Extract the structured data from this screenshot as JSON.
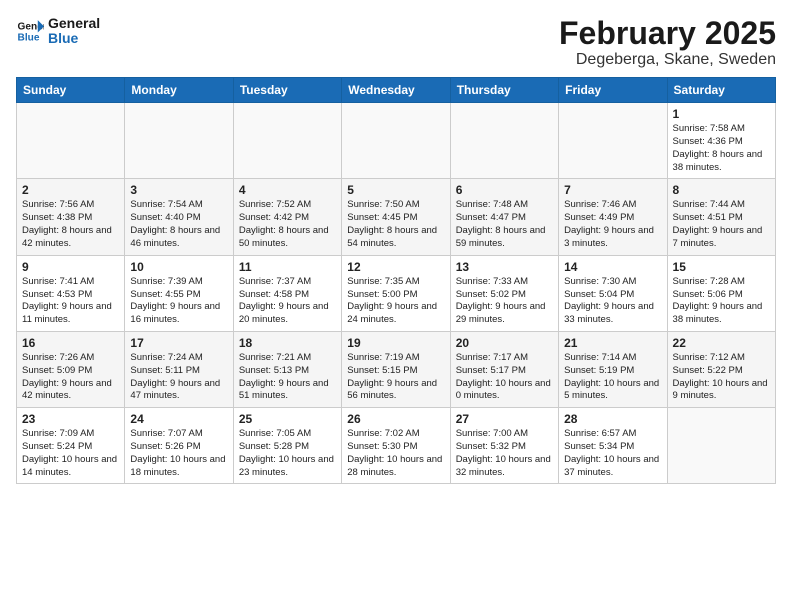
{
  "logo": {
    "line1": "General",
    "line2": "Blue"
  },
  "title": "February 2025",
  "location": "Degeberga, Skane, Sweden",
  "weekdays": [
    "Sunday",
    "Monday",
    "Tuesday",
    "Wednesday",
    "Thursday",
    "Friday",
    "Saturday"
  ],
  "weeks": [
    [
      {
        "day": "",
        "info": ""
      },
      {
        "day": "",
        "info": ""
      },
      {
        "day": "",
        "info": ""
      },
      {
        "day": "",
        "info": ""
      },
      {
        "day": "",
        "info": ""
      },
      {
        "day": "",
        "info": ""
      },
      {
        "day": "1",
        "info": "Sunrise: 7:58 AM\nSunset: 4:36 PM\nDaylight: 8 hours and 38 minutes."
      }
    ],
    [
      {
        "day": "2",
        "info": "Sunrise: 7:56 AM\nSunset: 4:38 PM\nDaylight: 8 hours and 42 minutes."
      },
      {
        "day": "3",
        "info": "Sunrise: 7:54 AM\nSunset: 4:40 PM\nDaylight: 8 hours and 46 minutes."
      },
      {
        "day": "4",
        "info": "Sunrise: 7:52 AM\nSunset: 4:42 PM\nDaylight: 8 hours and 50 minutes."
      },
      {
        "day": "5",
        "info": "Sunrise: 7:50 AM\nSunset: 4:45 PM\nDaylight: 8 hours and 54 minutes."
      },
      {
        "day": "6",
        "info": "Sunrise: 7:48 AM\nSunset: 4:47 PM\nDaylight: 8 hours and 59 minutes."
      },
      {
        "day": "7",
        "info": "Sunrise: 7:46 AM\nSunset: 4:49 PM\nDaylight: 9 hours and 3 minutes."
      },
      {
        "day": "8",
        "info": "Sunrise: 7:44 AM\nSunset: 4:51 PM\nDaylight: 9 hours and 7 minutes."
      }
    ],
    [
      {
        "day": "9",
        "info": "Sunrise: 7:41 AM\nSunset: 4:53 PM\nDaylight: 9 hours and 11 minutes."
      },
      {
        "day": "10",
        "info": "Sunrise: 7:39 AM\nSunset: 4:55 PM\nDaylight: 9 hours and 16 minutes."
      },
      {
        "day": "11",
        "info": "Sunrise: 7:37 AM\nSunset: 4:58 PM\nDaylight: 9 hours and 20 minutes."
      },
      {
        "day": "12",
        "info": "Sunrise: 7:35 AM\nSunset: 5:00 PM\nDaylight: 9 hours and 24 minutes."
      },
      {
        "day": "13",
        "info": "Sunrise: 7:33 AM\nSunset: 5:02 PM\nDaylight: 9 hours and 29 minutes."
      },
      {
        "day": "14",
        "info": "Sunrise: 7:30 AM\nSunset: 5:04 PM\nDaylight: 9 hours and 33 minutes."
      },
      {
        "day": "15",
        "info": "Sunrise: 7:28 AM\nSunset: 5:06 PM\nDaylight: 9 hours and 38 minutes."
      }
    ],
    [
      {
        "day": "16",
        "info": "Sunrise: 7:26 AM\nSunset: 5:09 PM\nDaylight: 9 hours and 42 minutes."
      },
      {
        "day": "17",
        "info": "Sunrise: 7:24 AM\nSunset: 5:11 PM\nDaylight: 9 hours and 47 minutes."
      },
      {
        "day": "18",
        "info": "Sunrise: 7:21 AM\nSunset: 5:13 PM\nDaylight: 9 hours and 51 minutes."
      },
      {
        "day": "19",
        "info": "Sunrise: 7:19 AM\nSunset: 5:15 PM\nDaylight: 9 hours and 56 minutes."
      },
      {
        "day": "20",
        "info": "Sunrise: 7:17 AM\nSunset: 5:17 PM\nDaylight: 10 hours and 0 minutes."
      },
      {
        "day": "21",
        "info": "Sunrise: 7:14 AM\nSunset: 5:19 PM\nDaylight: 10 hours and 5 minutes."
      },
      {
        "day": "22",
        "info": "Sunrise: 7:12 AM\nSunset: 5:22 PM\nDaylight: 10 hours and 9 minutes."
      }
    ],
    [
      {
        "day": "23",
        "info": "Sunrise: 7:09 AM\nSunset: 5:24 PM\nDaylight: 10 hours and 14 minutes."
      },
      {
        "day": "24",
        "info": "Sunrise: 7:07 AM\nSunset: 5:26 PM\nDaylight: 10 hours and 18 minutes."
      },
      {
        "day": "25",
        "info": "Sunrise: 7:05 AM\nSunset: 5:28 PM\nDaylight: 10 hours and 23 minutes."
      },
      {
        "day": "26",
        "info": "Sunrise: 7:02 AM\nSunset: 5:30 PM\nDaylight: 10 hours and 28 minutes."
      },
      {
        "day": "27",
        "info": "Sunrise: 7:00 AM\nSunset: 5:32 PM\nDaylight: 10 hours and 32 minutes."
      },
      {
        "day": "28",
        "info": "Sunrise: 6:57 AM\nSunset: 5:34 PM\nDaylight: 10 hours and 37 minutes."
      },
      {
        "day": "",
        "info": ""
      }
    ]
  ]
}
